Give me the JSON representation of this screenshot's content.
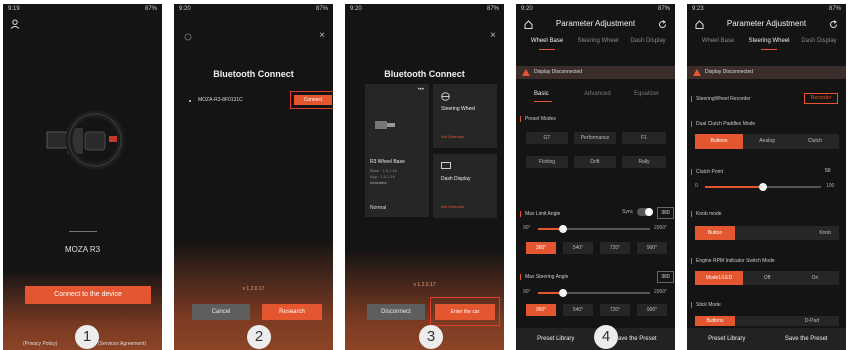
{
  "steps": [
    "1",
    "2",
    "3",
    "4"
  ],
  "p1": {
    "time": "9:19",
    "status_right": "87%",
    "device_name": "MOZA R3",
    "connect_button": "Connect to the device",
    "privacy": "(Privacy Policy)",
    "agreement": "(Services Agreement)"
  },
  "p2": {
    "time": "9:20",
    "status_right": "87%",
    "title": "Bluetooth Connect",
    "device": "MOZA-R3-8F0131C",
    "connect": "Connect",
    "version": "v 1.2.0.17",
    "cancel": "Cancel",
    "research": "Research"
  },
  "p3": {
    "time": "9:20",
    "status_right": "87%",
    "title": "Bluetooth Connect",
    "base_title": "R3 Wheel Base",
    "base_detail_1": "Base : 1.0.1.16",
    "base_detail_2": "App : 1.0.1.16",
    "base_detail_3": "Activated",
    "normal": "Normal",
    "steering_wheel": "Steering Wheel",
    "sw_status": "Not Detected",
    "dash": "Dash Display",
    "dash_status": "Not Detected",
    "version": "v 1.2.0.17",
    "disconnect": "Disconnect",
    "enter": "Enter the car"
  },
  "p4": {
    "time": "9:20",
    "status_right": "87%",
    "title": "Parameter Adjustment",
    "tabs": [
      "Wheel Base",
      "Steering Wheel",
      "Dash Display"
    ],
    "warning": "Display Disconnected",
    "subtabs": [
      "Basic",
      "Advanced",
      "Equalizer"
    ],
    "preset_label": "Preset Modes",
    "presets": [
      "GT",
      "Performance",
      "F1",
      "Fishing",
      "Drift",
      "Rally"
    ],
    "max_limit_label": "Max Limit Angle",
    "sync": "Sync",
    "max_limit_value": "360",
    "limit_min": "90°",
    "limit_max": "2000°",
    "limit_options": [
      "360°",
      "540°",
      "720°",
      "900°"
    ],
    "max_steer_label": "Max Steering Angle",
    "max_steer_value": "360",
    "steer_min": "90°",
    "steer_max": "2000°",
    "steer_options": [
      "360°",
      "540°",
      "720°",
      "900°"
    ],
    "preset_library": "Preset Library",
    "save_preset": "Save the Preset"
  },
  "p5": {
    "time": "9:23",
    "status_right": "87%",
    "title": "Parameter Adjustment",
    "tabs": [
      "Wheel Base",
      "Steering Wheel",
      "Dash Display"
    ],
    "warning": "Display Disconnected",
    "recorder_label": "SteeringWheel Recorder",
    "recorder_button": "Recorder",
    "dual_clutch_label": "Dual Clutch Paddles Mode",
    "clutch_modes": [
      "Buttons",
      "Analog",
      "Clutch"
    ],
    "clutch_point_label": "Clutch Point",
    "clutch_point_value": "50",
    "clutch_min": "0",
    "clutch_max": "100",
    "knob_label": "Knob mode",
    "knob_modes": [
      "Button",
      "Knob"
    ],
    "rpm_label": "Engine RPM Indicator Switch Mode",
    "rpm_modes": [
      "Mode1/LED",
      "Off",
      "On"
    ],
    "stick_label": "Stick Mode",
    "stick_modes": [
      "Buttons",
      "D-Pad"
    ],
    "preset_library": "Preset Library",
    "save_preset": "Save the Preset"
  }
}
